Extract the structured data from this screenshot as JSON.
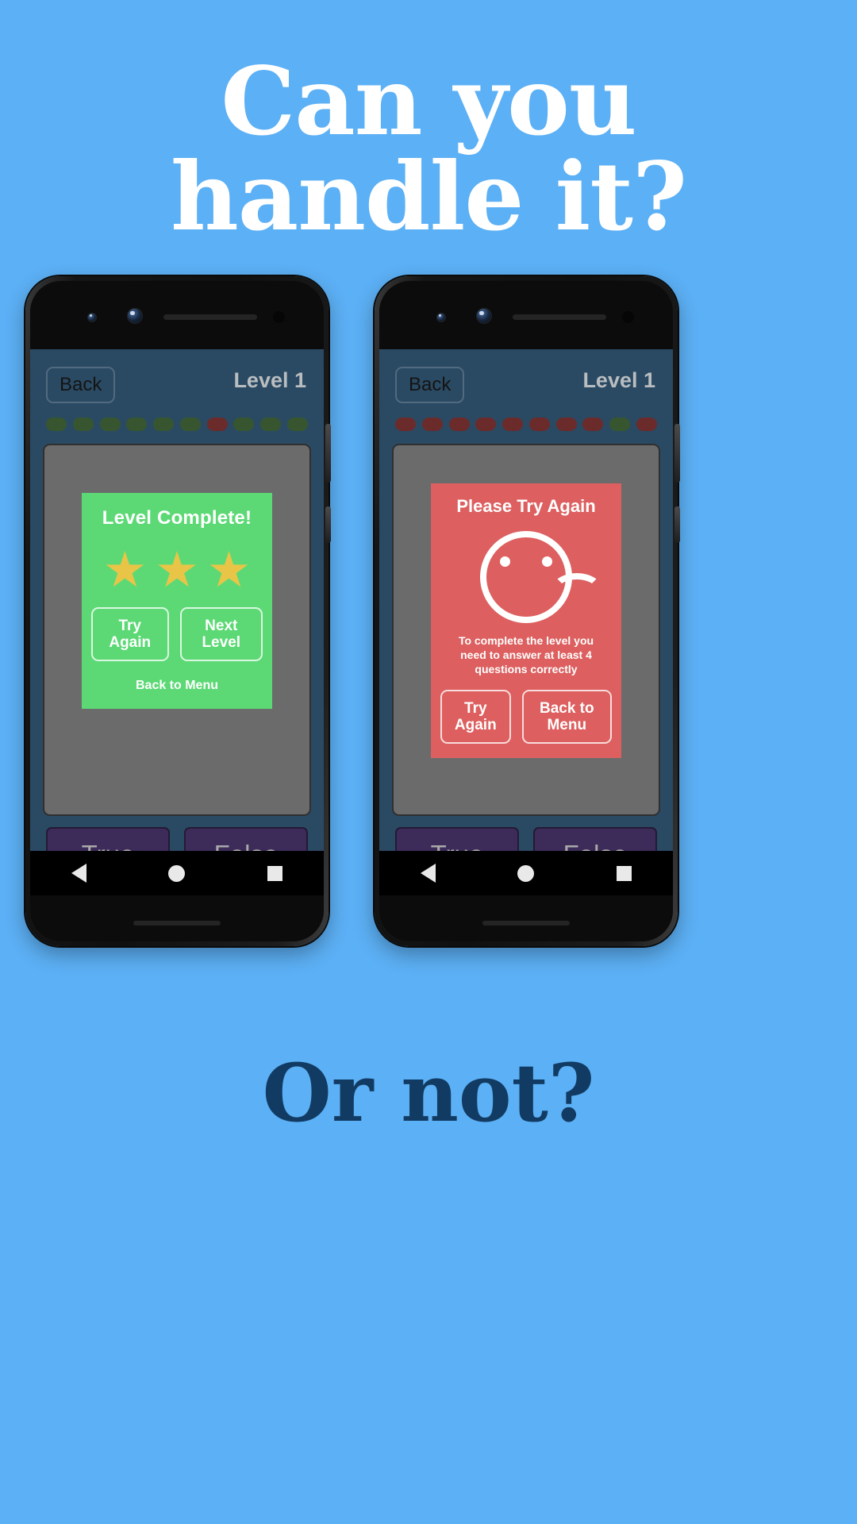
{
  "page": {
    "background_color": "#5cb0f5",
    "headline_top_lines": [
      "Can you",
      "handle it?"
    ],
    "headline_bottom": "Or not?",
    "headline_top_color": "#ffffff",
    "headline_bottom_color": "#123b63"
  },
  "phones": [
    {
      "id": "left-phone",
      "app": {
        "background_color": "#2a4a63",
        "back_label": "Back",
        "level_label": "Level 1",
        "progress_pills": [
          "green",
          "green",
          "green",
          "green",
          "green",
          "green",
          "red",
          "green",
          "green",
          "green"
        ],
        "pill_colors": {
          "green": "#37562f",
          "red": "#6b2b2b"
        }
      },
      "dialog": {
        "kind": "success",
        "background_color": "#5cd975",
        "title": "Level Complete!",
        "stars": 3,
        "star_glyph": "★",
        "star_color": "#e8c547",
        "buttons": [
          "Try Again",
          "Next Level"
        ],
        "footer_link": "Back to Menu"
      },
      "answers": [
        "True",
        "False"
      ],
      "navbar": [
        "back-triangle-icon",
        "home-circle-icon",
        "recents-square-icon"
      ]
    },
    {
      "id": "right-phone",
      "app": {
        "background_color": "#2a4a63",
        "back_label": "Back",
        "level_label": "Level 1",
        "progress_pills": [
          "red",
          "red",
          "red",
          "red",
          "red",
          "red",
          "red",
          "red",
          "green",
          "red"
        ],
        "pill_colors": {
          "green": "#37562f",
          "red": "#6b2b2b"
        }
      },
      "dialog": {
        "kind": "failure",
        "background_color": "#dd5f5f",
        "title": "Please Try Again",
        "icon": "sad-face-icon",
        "message": "To complete the level you need to answer at least 4 questions correctly",
        "buttons": [
          "Try Again",
          "Back to Menu"
        ]
      },
      "answers": [
        "True",
        "False"
      ],
      "navbar": [
        "back-triangle-icon",
        "home-circle-icon",
        "recents-square-icon"
      ]
    }
  ]
}
